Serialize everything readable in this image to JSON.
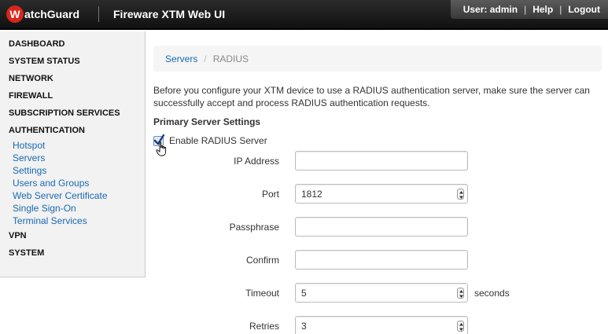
{
  "header": {
    "logo_letter": "W",
    "logo_text": "atchGuard",
    "app_title": "Fireware XTM Web UI",
    "user_label": "User: admin",
    "help": "Help",
    "logout": "Logout"
  },
  "sidebar": {
    "items": [
      {
        "label": "DASHBOARD"
      },
      {
        "label": "SYSTEM STATUS"
      },
      {
        "label": "NETWORK"
      },
      {
        "label": "FIREWALL"
      },
      {
        "label": "SUBSCRIPTION SERVICES"
      },
      {
        "label": "AUTHENTICATION"
      }
    ],
    "auth_sub": [
      "Hotspot",
      "Servers",
      "Settings",
      "Users and Groups",
      "Web Server Certificate",
      "Single Sign-On",
      "Terminal Services"
    ],
    "bottom_items": [
      {
        "label": "VPN"
      },
      {
        "label": "SYSTEM"
      }
    ]
  },
  "breadcrumb": {
    "parent": "Servers",
    "separator": "/",
    "current": "RADIUS"
  },
  "intro_line1": "Before you configure your XTM device to use a RADIUS authentication server, make sure the server can",
  "intro_line2": "successfully accept and process RADIUS authentication requests.",
  "section_title": "Primary Server Settings",
  "enable_label": "Enable RADIUS Server",
  "enable_checked": true,
  "form": {
    "ip_label": "IP Address",
    "ip_value": "",
    "port_label": "Port",
    "port_value": "1812",
    "pass_label": "Passphrase",
    "pass_value": "",
    "confirm_label": "Confirm",
    "confirm_value": "",
    "timeout_label": "Timeout",
    "timeout_value": "5",
    "timeout_unit": "seconds",
    "retries_label": "Retries",
    "retries_value": "3"
  },
  "colors": {
    "link": "#1a69b4",
    "logo_red": "#d9261c",
    "topbar": "#1a1a1a"
  }
}
